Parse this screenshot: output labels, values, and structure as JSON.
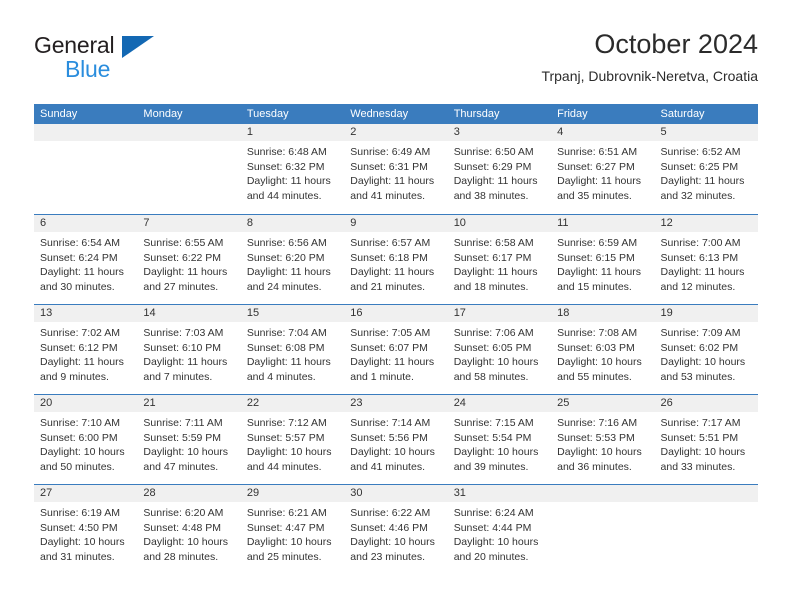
{
  "brand": {
    "name_part1": "General",
    "name_part2": "Blue",
    "triangle_color": "#1368b3",
    "blue_text_color": "#2a8ddd"
  },
  "header": {
    "title": "October 2024",
    "subtitle": "Trpanj, Dubrovnik-Neretva, Croatia"
  },
  "theme": {
    "header_blue": "#3a7cbe",
    "date_band_gray": "#f0f0f0",
    "text_color": "#333333"
  },
  "weekdays": [
    "Sunday",
    "Monday",
    "Tuesday",
    "Wednesday",
    "Thursday",
    "Friday",
    "Saturday"
  ],
  "weeks": [
    [
      {
        "day": "",
        "sunrise": "",
        "sunset": "",
        "daylight": "",
        "empty": true
      },
      {
        "day": "",
        "sunrise": "",
        "sunset": "",
        "daylight": "",
        "empty": true
      },
      {
        "day": "1",
        "sunrise": "Sunrise: 6:48 AM",
        "sunset": "Sunset: 6:32 PM",
        "daylight": "Daylight: 11 hours and 44 minutes.",
        "empty": false
      },
      {
        "day": "2",
        "sunrise": "Sunrise: 6:49 AM",
        "sunset": "Sunset: 6:31 PM",
        "daylight": "Daylight: 11 hours and 41 minutes.",
        "empty": false
      },
      {
        "day": "3",
        "sunrise": "Sunrise: 6:50 AM",
        "sunset": "Sunset: 6:29 PM",
        "daylight": "Daylight: 11 hours and 38 minutes.",
        "empty": false
      },
      {
        "day": "4",
        "sunrise": "Sunrise: 6:51 AM",
        "sunset": "Sunset: 6:27 PM",
        "daylight": "Daylight: 11 hours and 35 minutes.",
        "empty": false
      },
      {
        "day": "5",
        "sunrise": "Sunrise: 6:52 AM",
        "sunset": "Sunset: 6:25 PM",
        "daylight": "Daylight: 11 hours and 32 minutes.",
        "empty": false
      }
    ],
    [
      {
        "day": "6",
        "sunrise": "Sunrise: 6:54 AM",
        "sunset": "Sunset: 6:24 PM",
        "daylight": "Daylight: 11 hours and 30 minutes.",
        "empty": false
      },
      {
        "day": "7",
        "sunrise": "Sunrise: 6:55 AM",
        "sunset": "Sunset: 6:22 PM",
        "daylight": "Daylight: 11 hours and 27 minutes.",
        "empty": false
      },
      {
        "day": "8",
        "sunrise": "Sunrise: 6:56 AM",
        "sunset": "Sunset: 6:20 PM",
        "daylight": "Daylight: 11 hours and 24 minutes.",
        "empty": false
      },
      {
        "day": "9",
        "sunrise": "Sunrise: 6:57 AM",
        "sunset": "Sunset: 6:18 PM",
        "daylight": "Daylight: 11 hours and 21 minutes.",
        "empty": false
      },
      {
        "day": "10",
        "sunrise": "Sunrise: 6:58 AM",
        "sunset": "Sunset: 6:17 PM",
        "daylight": "Daylight: 11 hours and 18 minutes.",
        "empty": false
      },
      {
        "day": "11",
        "sunrise": "Sunrise: 6:59 AM",
        "sunset": "Sunset: 6:15 PM",
        "daylight": "Daylight: 11 hours and 15 minutes.",
        "empty": false
      },
      {
        "day": "12",
        "sunrise": "Sunrise: 7:00 AM",
        "sunset": "Sunset: 6:13 PM",
        "daylight": "Daylight: 11 hours and 12 minutes.",
        "empty": false
      }
    ],
    [
      {
        "day": "13",
        "sunrise": "Sunrise: 7:02 AM",
        "sunset": "Sunset: 6:12 PM",
        "daylight": "Daylight: 11 hours and 9 minutes.",
        "empty": false
      },
      {
        "day": "14",
        "sunrise": "Sunrise: 7:03 AM",
        "sunset": "Sunset: 6:10 PM",
        "daylight": "Daylight: 11 hours and 7 minutes.",
        "empty": false
      },
      {
        "day": "15",
        "sunrise": "Sunrise: 7:04 AM",
        "sunset": "Sunset: 6:08 PM",
        "daylight": "Daylight: 11 hours and 4 minutes.",
        "empty": false
      },
      {
        "day": "16",
        "sunrise": "Sunrise: 7:05 AM",
        "sunset": "Sunset: 6:07 PM",
        "daylight": "Daylight: 11 hours and 1 minute.",
        "empty": false
      },
      {
        "day": "17",
        "sunrise": "Sunrise: 7:06 AM",
        "sunset": "Sunset: 6:05 PM",
        "daylight": "Daylight: 10 hours and 58 minutes.",
        "empty": false
      },
      {
        "day": "18",
        "sunrise": "Sunrise: 7:08 AM",
        "sunset": "Sunset: 6:03 PM",
        "daylight": "Daylight: 10 hours and 55 minutes.",
        "empty": false
      },
      {
        "day": "19",
        "sunrise": "Sunrise: 7:09 AM",
        "sunset": "Sunset: 6:02 PM",
        "daylight": "Daylight: 10 hours and 53 minutes.",
        "empty": false
      }
    ],
    [
      {
        "day": "20",
        "sunrise": "Sunrise: 7:10 AM",
        "sunset": "Sunset: 6:00 PM",
        "daylight": "Daylight: 10 hours and 50 minutes.",
        "empty": false
      },
      {
        "day": "21",
        "sunrise": "Sunrise: 7:11 AM",
        "sunset": "Sunset: 5:59 PM",
        "daylight": "Daylight: 10 hours and 47 minutes.",
        "empty": false
      },
      {
        "day": "22",
        "sunrise": "Sunrise: 7:12 AM",
        "sunset": "Sunset: 5:57 PM",
        "daylight": "Daylight: 10 hours and 44 minutes.",
        "empty": false
      },
      {
        "day": "23",
        "sunrise": "Sunrise: 7:14 AM",
        "sunset": "Sunset: 5:56 PM",
        "daylight": "Daylight: 10 hours and 41 minutes.",
        "empty": false
      },
      {
        "day": "24",
        "sunrise": "Sunrise: 7:15 AM",
        "sunset": "Sunset: 5:54 PM",
        "daylight": "Daylight: 10 hours and 39 minutes.",
        "empty": false
      },
      {
        "day": "25",
        "sunrise": "Sunrise: 7:16 AM",
        "sunset": "Sunset: 5:53 PM",
        "daylight": "Daylight: 10 hours and 36 minutes.",
        "empty": false
      },
      {
        "day": "26",
        "sunrise": "Sunrise: 7:17 AM",
        "sunset": "Sunset: 5:51 PM",
        "daylight": "Daylight: 10 hours and 33 minutes.",
        "empty": false
      }
    ],
    [
      {
        "day": "27",
        "sunrise": "Sunrise: 6:19 AM",
        "sunset": "Sunset: 4:50 PM",
        "daylight": "Daylight: 10 hours and 31 minutes.",
        "empty": false
      },
      {
        "day": "28",
        "sunrise": "Sunrise: 6:20 AM",
        "sunset": "Sunset: 4:48 PM",
        "daylight": "Daylight: 10 hours and 28 minutes.",
        "empty": false
      },
      {
        "day": "29",
        "sunrise": "Sunrise: 6:21 AM",
        "sunset": "Sunset: 4:47 PM",
        "daylight": "Daylight: 10 hours and 25 minutes.",
        "empty": false
      },
      {
        "day": "30",
        "sunrise": "Sunrise: 6:22 AM",
        "sunset": "Sunset: 4:46 PM",
        "daylight": "Daylight: 10 hours and 23 minutes.",
        "empty": false
      },
      {
        "day": "31",
        "sunrise": "Sunrise: 6:24 AM",
        "sunset": "Sunset: 4:44 PM",
        "daylight": "Daylight: 10 hours and 20 minutes.",
        "empty": false
      },
      {
        "day": "",
        "sunrise": "",
        "sunset": "",
        "daylight": "",
        "empty": true
      },
      {
        "day": "",
        "sunrise": "",
        "sunset": "",
        "daylight": "",
        "empty": true
      }
    ]
  ]
}
